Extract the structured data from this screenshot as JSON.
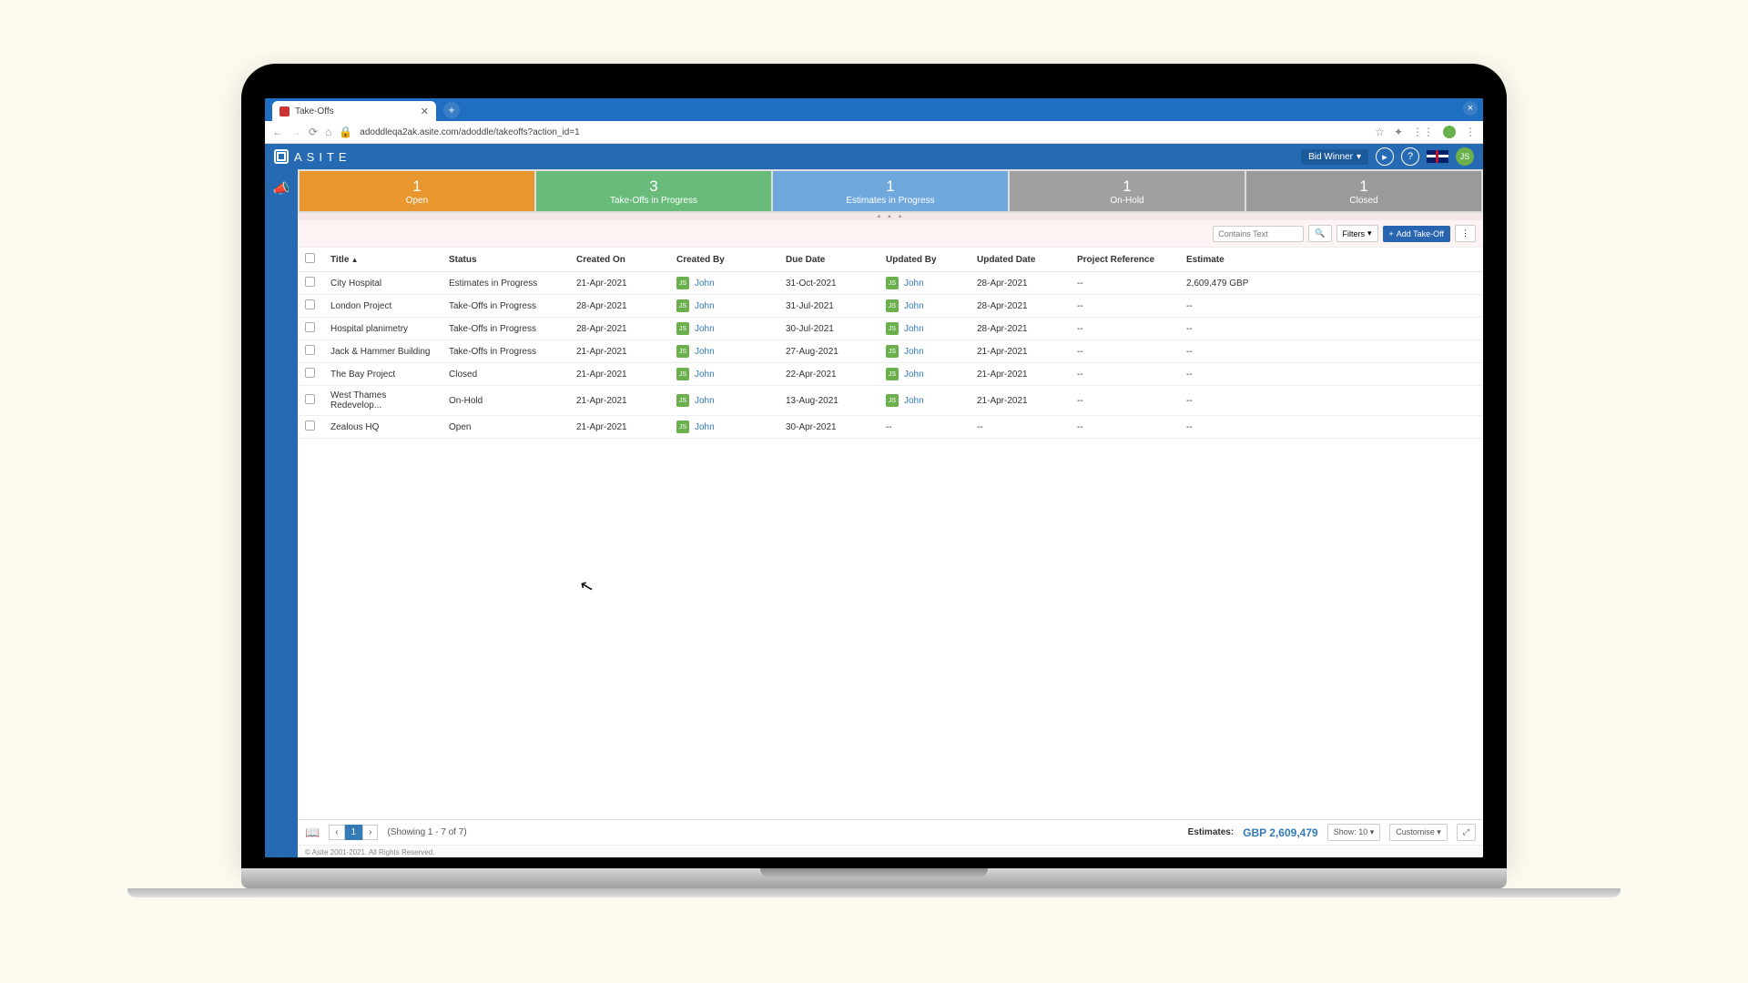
{
  "browser": {
    "tab_title": "Take-Offs",
    "url": "adoddleqa2ak.asite.com/adoddle/takeoffs?action_id=1"
  },
  "header": {
    "brand": "ASITE",
    "role_selector": "Bid Winner",
    "avatar_initials": "JS"
  },
  "status_cards": [
    {
      "count": "1",
      "label": "Open",
      "class": "c-open"
    },
    {
      "count": "3",
      "label": "Take-Offs in Progress",
      "class": "c-prog"
    },
    {
      "count": "1",
      "label": "Estimates in Progress",
      "class": "c-est"
    },
    {
      "count": "1",
      "label": "On-Hold",
      "class": "c-hold"
    },
    {
      "count": "1",
      "label": "Closed",
      "class": "c-closed"
    }
  ],
  "toolbar": {
    "search_ph": "Contains Text",
    "filters_label": "Filters",
    "add_label": "Add Take-Off"
  },
  "columns": {
    "title": "Title",
    "status": "Status",
    "created_on": "Created On",
    "created_by": "Created By",
    "due_date": "Due Date",
    "updated_by": "Updated By",
    "updated_date": "Updated Date",
    "project_ref": "Project Reference",
    "estimate": "Estimate"
  },
  "rows": [
    {
      "title": "City Hospital",
      "status": "Estimates in Progress",
      "created_on": "21-Apr-2021",
      "created_by": "John",
      "due": "31-Oct-2021",
      "updated_by": "John",
      "updated_date": "28-Apr-2021",
      "ref": "--",
      "estimate": "2,609,479 GBP"
    },
    {
      "title": "London Project",
      "status": "Take-Offs in Progress",
      "created_on": "28-Apr-2021",
      "created_by": "John",
      "due": "31-Jul-2021",
      "updated_by": "John",
      "updated_date": "28-Apr-2021",
      "ref": "--",
      "estimate": "--"
    },
    {
      "title": "Hospital planimetry",
      "status": "Take-Offs in Progress",
      "created_on": "28-Apr-2021",
      "created_by": "John",
      "due": "30-Jul-2021",
      "updated_by": "John",
      "updated_date": "28-Apr-2021",
      "ref": "--",
      "estimate": "--"
    },
    {
      "title": "Jack & Hammer Building",
      "status": "Take-Offs in Progress",
      "created_on": "21-Apr-2021",
      "created_by": "John",
      "due": "27-Aug-2021",
      "updated_by": "John",
      "updated_date": "21-Apr-2021",
      "ref": "--",
      "estimate": "--"
    },
    {
      "title": "The Bay Project",
      "status": "Closed",
      "created_on": "21-Apr-2021",
      "created_by": "John",
      "due": "22-Apr-2021",
      "updated_by": "John",
      "updated_date": "21-Apr-2021",
      "ref": "--",
      "estimate": "--"
    },
    {
      "title": "West Thames Redevelop...",
      "status": "On-Hold",
      "created_on": "21-Apr-2021",
      "created_by": "John",
      "due": "13-Aug-2021",
      "updated_by": "John",
      "updated_date": "21-Apr-2021",
      "ref": "--",
      "estimate": "--"
    },
    {
      "title": "Zealous HQ",
      "status": "Open",
      "created_on": "21-Apr-2021",
      "created_by": "John",
      "due": "30-Apr-2021",
      "updated_by": "--",
      "updated_date": "--",
      "ref": "--",
      "estimate": "--"
    }
  ],
  "user_chip": "JS",
  "footer": {
    "page": "1",
    "showing": "(Showing 1 - 7 of 7)",
    "est_label": "Estimates:",
    "est_val": "GBP 2,609,479",
    "show_label": "Show: 10",
    "customise": "Customise"
  },
  "copyright": "© Asite 2001-2021. All Rights Reserved."
}
